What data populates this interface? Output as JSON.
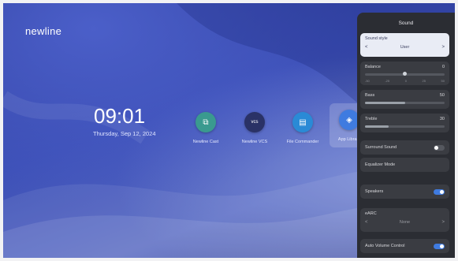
{
  "desktop": {
    "logo": "newline",
    "time": "09:01",
    "date": "Thursday, Sep 12, 2024",
    "apps": [
      {
        "label": "Newline Cast",
        "icon": "cast-icon",
        "color": "#3a9a8f",
        "glyph": "⧉"
      },
      {
        "label": "Newline VCS",
        "icon": "vcs-icon",
        "color": "#2a3266",
        "glyph": "vcs"
      },
      {
        "label": "File Commander",
        "icon": "folder-icon",
        "color": "#2a8ad6",
        "glyph": "▤"
      },
      {
        "label": "App Library",
        "icon": "app-library-icon",
        "color": "#3f7be0",
        "glyph": "◈"
      }
    ]
  },
  "panel": {
    "title": "Sound",
    "sound_style": {
      "label": "Sound style",
      "value": "User",
      "prev": "<",
      "next": ">"
    },
    "balance": {
      "label": "Balance",
      "value": "0",
      "ticks": [
        "-50",
        "-25",
        "0",
        "25",
        "50"
      ],
      "level": 0.0
    },
    "bass": {
      "label": "Bass",
      "value": "50",
      "level": 0.5
    },
    "treble": {
      "label": "Treble",
      "value": "30",
      "level": 0.3
    },
    "surround": {
      "label": "Surround Sound",
      "on": false
    },
    "equalizer": {
      "label": "Equalizer Mode"
    },
    "speakers": {
      "label": "Speakers",
      "on": true
    },
    "arc": {
      "label": "eARC",
      "value": "None",
      "prev": "<",
      "next": ">"
    },
    "auto_volume": {
      "label": "Auto Volume Control",
      "on": true
    }
  },
  "colors": {
    "accent": "#3f7be0",
    "panel_bg": "#2b2d33"
  }
}
